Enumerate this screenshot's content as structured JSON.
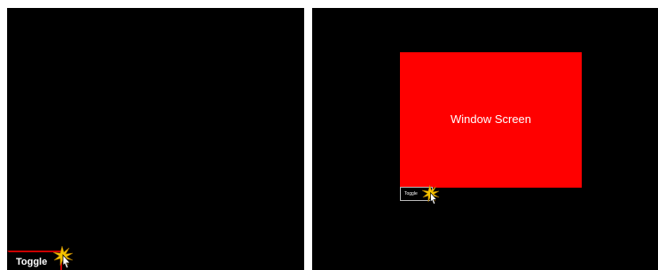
{
  "left_panel": {
    "toggle_label": "Toggle"
  },
  "right_panel": {
    "window_screen_label": "Window Screen",
    "toggle_label": "Toggle"
  },
  "icons": {
    "cursor": "click-hand-cursor-icon"
  },
  "colors": {
    "background": "#000000",
    "window_screen": "#ff0000",
    "toggle_border_active": "#cc0000"
  }
}
